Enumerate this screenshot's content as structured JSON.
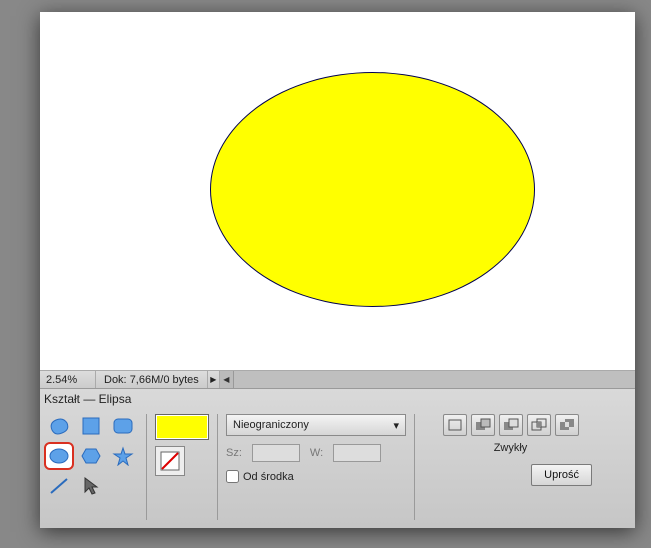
{
  "statusbar": {
    "zoom": "2.54%",
    "doc_label": "Dok:",
    "doc_value": "7,66M/0 bytes"
  },
  "panel": {
    "title": "Kształt — Elipsa",
    "dropdown_label": "Nieograniczony",
    "width_label": "Sz:",
    "width_value": "",
    "height_label": "W:",
    "height_value": "",
    "from_center_label": "Od środka",
    "mode_label": "Zwykły",
    "simplify_label": "Uprość",
    "fill_color": "#ffff00"
  },
  "shapes": {
    "blob": "blob-icon",
    "square": "square-icon",
    "rounded": "rounded-rect-icon",
    "ellipse": "ellipse-icon",
    "hexagon": "hexagon-icon",
    "star": "star-icon",
    "line": "line-icon",
    "pointer": "pointer-icon"
  }
}
